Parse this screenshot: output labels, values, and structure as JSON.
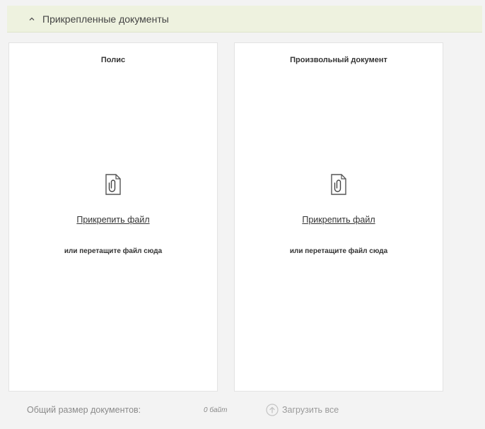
{
  "section": {
    "title": "Прикрепленные документы",
    "expanded": true
  },
  "documents": [
    {
      "title": "Полис",
      "attach_label": "Прикрепить файл",
      "drop_hint": "или перетащите файл сюда",
      "icon": "paperclip-document-icon"
    },
    {
      "title": "Произвольный документ",
      "attach_label": "Прикрепить файл",
      "drop_hint": "или перетащите файл сюда",
      "icon": "paperclip-document-icon"
    }
  ],
  "footer": {
    "total_size_label": "Общий размер документов:",
    "total_size_value": "0 байт",
    "upload_all_label": "Загрузить все",
    "upload_icon": "upload-icon"
  },
  "colors": {
    "header_bg": "#eef2df",
    "page_bg": "#f3f3f3",
    "card_bg": "#ffffff",
    "muted_text": "#8a8a8a"
  }
}
